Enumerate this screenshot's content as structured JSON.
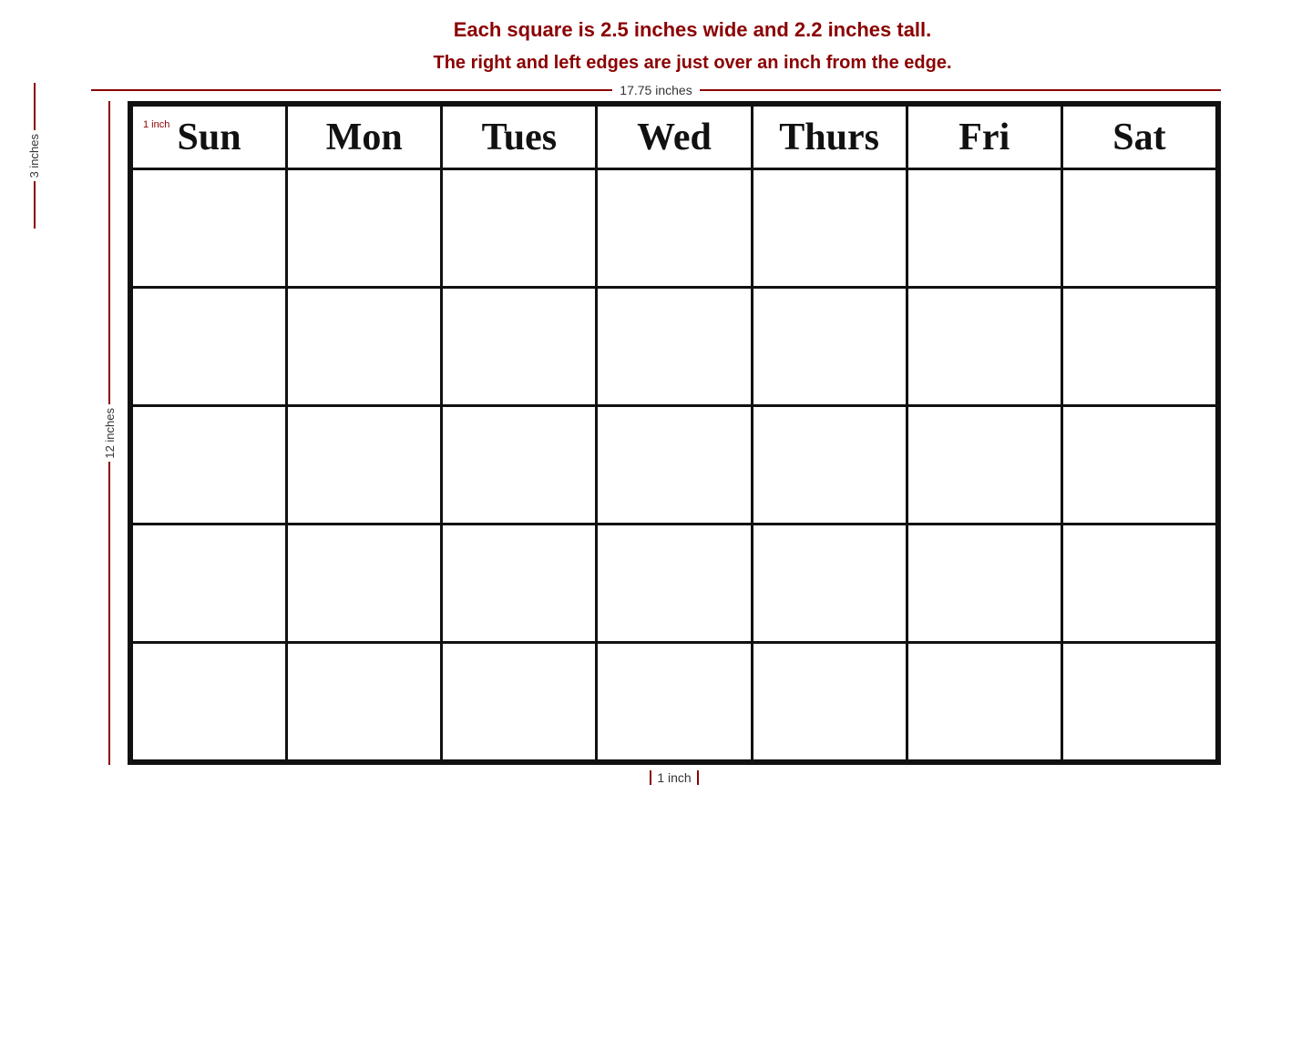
{
  "info": {
    "line1": "Each square is 2.5 inches wide and 2.2 inches tall.",
    "line2": "The right and left edges are just over an inch from the edge."
  },
  "measurements": {
    "top_horizontal": "17.75 inches",
    "left_vertical_top": "3 inches",
    "left_vertical_main": "12 inches",
    "bottom_center": "1 inch",
    "corner_label": "1 inch"
  },
  "days": {
    "sun": "Sun",
    "mon": "Mon",
    "tue": "Tues",
    "wed": "Wed",
    "thu": "Thurs",
    "fri": "Fri",
    "sat": "Sat"
  },
  "rows": 5,
  "cols": 7
}
